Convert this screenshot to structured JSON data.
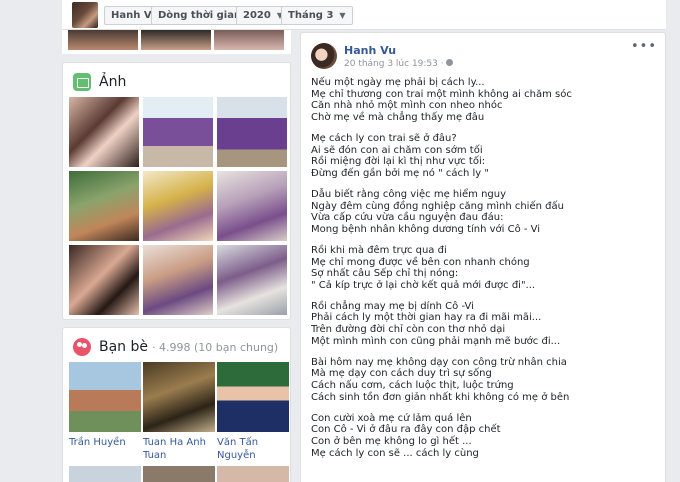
{
  "topbar": {
    "name": "Hanh Vu",
    "filter": "Dòng thời gian",
    "year": "2020",
    "month": "Tháng 3"
  },
  "photos": {
    "title": "Ảnh"
  },
  "friends": {
    "title": "Bạn bè",
    "count": "· 4.998 (10 bạn chung)",
    "people": [
      "Trần Huyền",
      "Tuan Ha Anh\nTuan",
      "Văn Tấn Nguyễn"
    ]
  },
  "post": {
    "author": "Hanh Vu",
    "time": "20 tháng 3 lúc 19:53 ·",
    "stanzas": [
      "Nếu một ngày mẹ phải bị cách ly...\nMẹ chỉ thương con trai một mình không ai chăm sóc\nCăn nhà nhỏ một mình con nheo nhóc\nChờ mẹ về mà chẳng thấy mẹ đâu",
      "Mẹ cách ly con trai sẽ ở đâu?\nAi sẽ đón con ai chăm con sớm tối\nRồi miệng đời lại kì thị như vực tối:\nĐừng đến gần bởi mẹ nó \" cách ly \"",
      "Dẫu biết rằng công việc mẹ hiểm nguy\nNgày đêm cùng đồng nghiệp căng mình chiến đấu\nVừa cấp cứu vừa cầu nguyện đau đáu:\nMong bệnh nhân không dương tính với Cô - Vi",
      "Rồi khi mà đêm trực qua đi\nMẹ chỉ mong được về bên con nhanh chóng\nSợ nhất câu Sếp chỉ thị nóng:\n\" Cả kíp trực ở lại chờ kết quả mới được đi\"...",
      "Rồi chẳng may mẹ bị dính Cô -Vi\nPhải cách ly một thời gian hay ra đi mãi mãi...\nTrên đường đời chỉ còn con thơ nhỏ dại\nMột mình mình con cũng phải mạnh mẽ bước đi...",
      "Bài hôm nay mẹ không dạy con công trừ nhân chia\nMà mẹ dạy con cách duy trì sự sống\nCách nấu cơm, cách luộc thịt, luộc trứng\nCách sinh tồn đơn giản nhất khi không có mẹ ở bên",
      "Con cười xoà mẹ cứ lảm quá lên\nCon Cô - Vi ở đâu ra đây con đập chết\nCon ở bên mẹ không lo gì hết ...\nMẹ cách ly con sẽ ... cách ly cùng"
    ]
  },
  "colors": {
    "link": "#365899",
    "page_bg": "#e9ebee",
    "photo_icon": "#63be72",
    "friends_icon": "#e9546b"
  },
  "icons": [
    "photo-icon",
    "friends-icon",
    "globe-icon",
    "more-icon",
    "caret-down-icon"
  ]
}
